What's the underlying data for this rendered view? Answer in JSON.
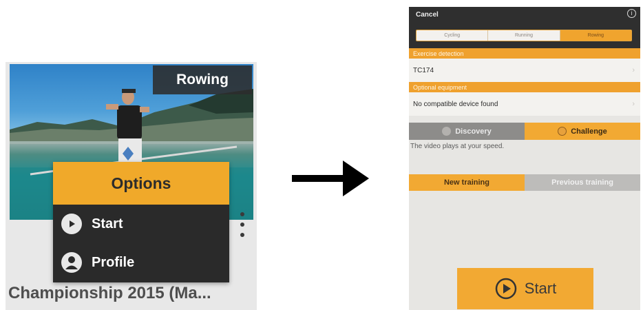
{
  "card": {
    "sport": "Rowing",
    "title": "Championship 2015 (Ma...",
    "menu": {
      "header": "Options",
      "items": [
        {
          "label": "Start",
          "icon": "play-icon"
        },
        {
          "label": "Profile",
          "icon": "user-icon"
        }
      ]
    }
  },
  "app": {
    "cancel": "Cancel",
    "tabs": [
      {
        "label": "Cycling",
        "active": false
      },
      {
        "label": "Running",
        "active": false
      },
      {
        "label": "Rowing",
        "active": true
      }
    ],
    "exercise_detection": {
      "header": "Exercise detection",
      "value": "TC174"
    },
    "optional_equipment": {
      "header": "Optional equipment",
      "value": "No compatible device found"
    },
    "modes": [
      {
        "label": "Discovery",
        "icon": "star-icon",
        "active": false
      },
      {
        "label": "Challenge",
        "icon": "trophy-icon",
        "active": true
      }
    ],
    "description": "The video plays at your speed.",
    "training": [
      {
        "label": "New training",
        "active": true
      },
      {
        "label": "Previous training",
        "active": false
      }
    ],
    "start": "Start"
  },
  "colors": {
    "accent": "#f0a92a",
    "dark": "#2a2a2a"
  }
}
